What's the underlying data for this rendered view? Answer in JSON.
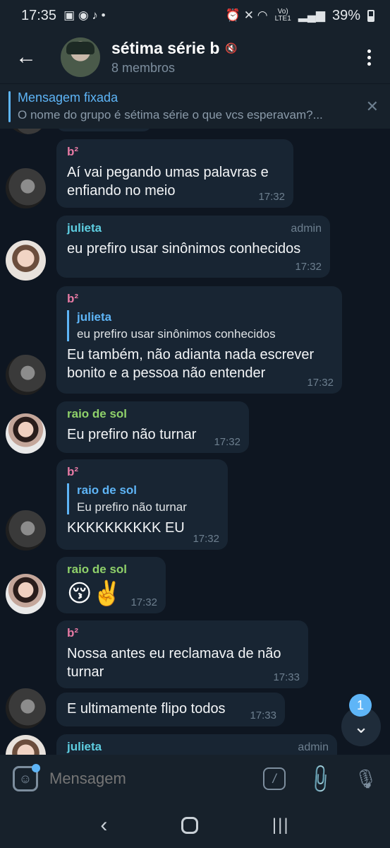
{
  "status": {
    "time": "17:35",
    "battery": "39%",
    "network": "LTE1",
    "volte": "Vo)"
  },
  "header": {
    "title": "sétima série b",
    "subtitle": "8 membros"
  },
  "pinned": {
    "title": "Mensagem fixada",
    "text": "O nome do grupo é sétima série o que vcs esperavam?..."
  },
  "messages": {
    "m1": {
      "sender": "b²",
      "text": "Aí vai pegando umas palavras e enfiando no meio",
      "time": "17:32"
    },
    "m2": {
      "sender": "julieta",
      "badge": "admin",
      "text": "eu prefiro usar sinônimos conhecidos",
      "time": "17:32"
    },
    "m3": {
      "sender": "b²",
      "reply_name": "julieta",
      "reply_text": "eu prefiro usar sinônimos conhecidos",
      "text": "Eu também, não adianta nada escrever bonito e a pessoa não entender",
      "time": "17:32"
    },
    "m4": {
      "sender": "raio de sol",
      "text": "Eu prefiro não turnar",
      "time": "17:32"
    },
    "m5": {
      "sender": "b²",
      "reply_name": "raio de sol",
      "reply_text": "Eu prefiro não turnar",
      "text": "KKKKKKKKKK EU",
      "time": "17:32"
    },
    "m6": {
      "sender": "raio de sol",
      "text": "😚✌️",
      "time": "17:32"
    },
    "m7": {
      "sender": "b²",
      "text": "Nossa antes eu reclamava de não turnar",
      "time": "17:33"
    },
    "m8": {
      "text": "E ultimamente flipo todos",
      "time": "17:33"
    },
    "m9": {
      "sender": "julieta",
      "badge": "admin"
    }
  },
  "unread_count": "1",
  "input": {
    "placeholder": "Mensagem"
  }
}
